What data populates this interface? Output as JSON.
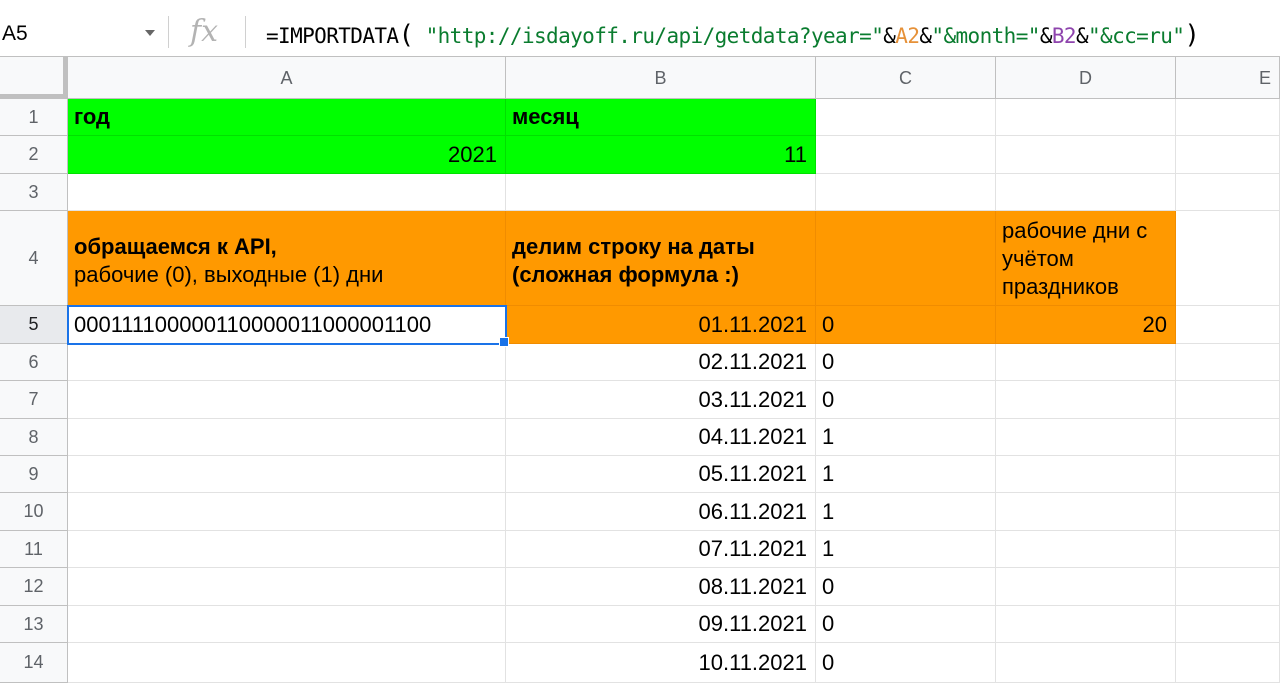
{
  "formula_bar": {
    "name_box": "A5",
    "fx_label": "fx",
    "formula_parts": {
      "prefix": "=IMPORTDATA",
      "paren_open": "(",
      "space": " ",
      "str1": "\"http://isdayoff.ru/api/getdata?year=\"",
      "amp1": "&",
      "ref1": "A2",
      "amp2": "&",
      "str2": "\"&month=\"",
      "amp3": "&",
      "ref2": "B2",
      "amp4": "&",
      "str3": "\"&cc=ru\"",
      "paren_close": ")"
    }
  },
  "columns": [
    "A",
    "B",
    "C",
    "D",
    "E"
  ],
  "rows": [
    "1",
    "2",
    "3",
    "4",
    "5",
    "6",
    "7",
    "8",
    "9",
    "10",
    "11",
    "12",
    "13",
    "14"
  ],
  "cells": {
    "A1": "год",
    "B1": "месяц",
    "A2": "2021",
    "B2": "11",
    "A4_line1": "обращаемся к API,",
    "A4_line2": "рабочие (0), выходные (1) дни",
    "B4_line1": "делим строку на даты",
    "B4_line2": "(сложная формула :)",
    "D4": "рабочие дни с учётом праздников",
    "A5": "000111100000110000011000001100",
    "D5": "20"
  },
  "dates": [
    {
      "date": "01.11.2021",
      "flag": "0"
    },
    {
      "date": "02.11.2021",
      "flag": "0"
    },
    {
      "date": "03.11.2021",
      "flag": "0"
    },
    {
      "date": "04.11.2021",
      "flag": "1"
    },
    {
      "date": "05.11.2021",
      "flag": "1"
    },
    {
      "date": "06.11.2021",
      "flag": "1"
    },
    {
      "date": "07.11.2021",
      "flag": "1"
    },
    {
      "date": "08.11.2021",
      "flag": "0"
    },
    {
      "date": "09.11.2021",
      "flag": "0"
    },
    {
      "date": "10.11.2021",
      "flag": "0"
    }
  ],
  "colors": {
    "header_fill_green": "#00ff00",
    "header_fill_orange": "#ff9900",
    "selection": "#1a73e8"
  }
}
